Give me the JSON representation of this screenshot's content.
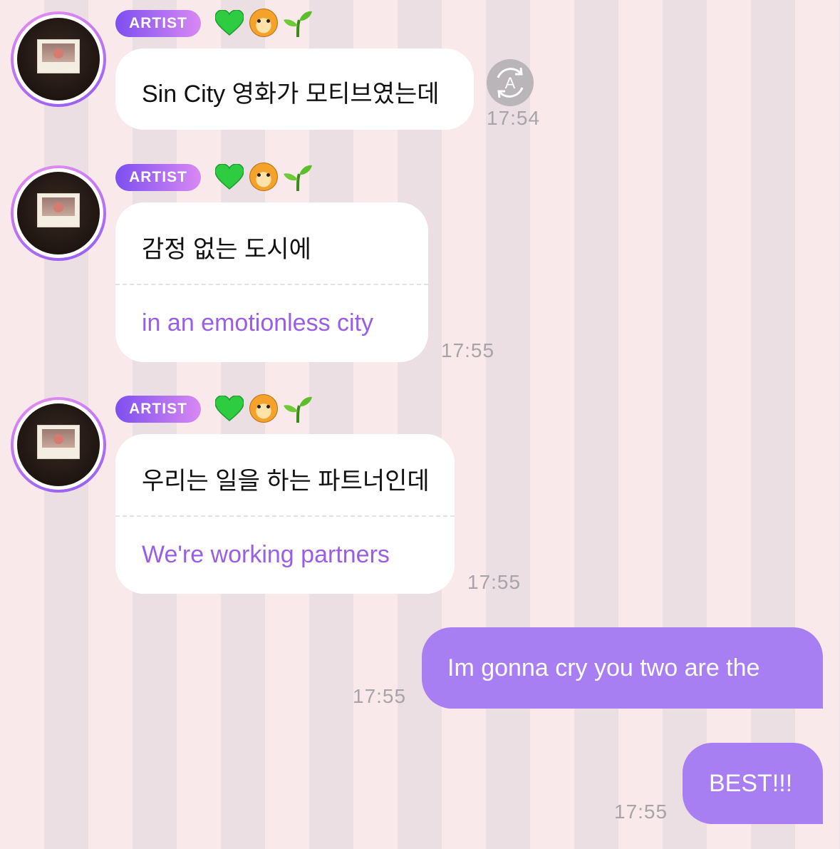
{
  "badge_label": "ARTIST",
  "icons": [
    "green-heart-icon",
    "tiger-face-icon",
    "seedling-icon"
  ],
  "colors": {
    "badge_start": "#7d4ff0",
    "badge_end": "#d889f2",
    "sent_bubble": "#a77ff3",
    "translation_text": "#9a5ee6"
  },
  "messages": [
    {
      "text": "Sin City 영화가 모티브였는데",
      "time": "17:54"
    },
    {
      "text": "감정 없는 도시에",
      "translation": "in an emotionless city",
      "time": "17:55"
    },
    {
      "text": "우리는 일을 하는 파트너인데",
      "translation": "We're working partners",
      "time": "17:55"
    }
  ],
  "sent": [
    {
      "text": "Im gonna cry you two are the",
      "time": "17:55"
    },
    {
      "text": "BEST!!!",
      "time": "17:55"
    }
  ]
}
